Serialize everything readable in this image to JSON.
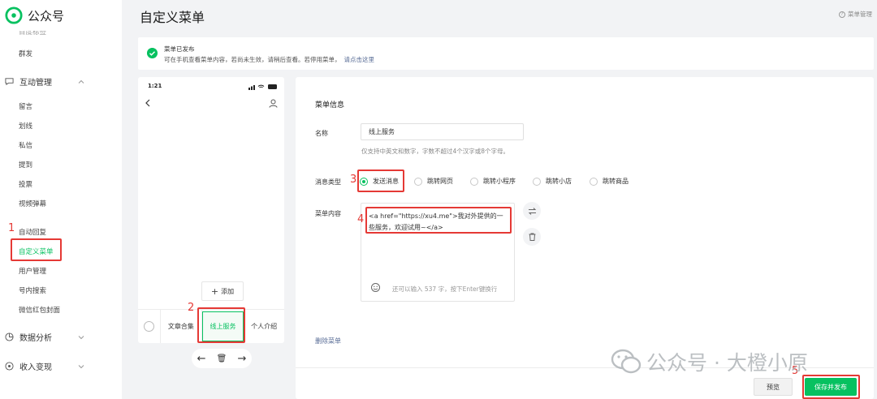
{
  "brand": {
    "name": "公众号"
  },
  "sidebar": {
    "cut_item": "百度标签",
    "items": [
      {
        "label": "群发"
      }
    ],
    "groups": {
      "interact": {
        "label": "互动管理",
        "items": [
          "留言",
          "划线",
          "私信",
          "提到",
          "投票",
          "视频弹幕"
        ]
      },
      "more_items": [
        "自动回复",
        "自定义菜单",
        "用户管理",
        "号内搜索",
        "微信红包封面"
      ],
      "analytics": {
        "label": "数据分析"
      },
      "revenue": {
        "label": "收入变现"
      }
    }
  },
  "header": {
    "title": "自定义菜单",
    "help": "菜单管理"
  },
  "notice": {
    "title": "菜单已发布",
    "text": "可在手机查看菜单内容，若尚未生效，请稍后查看。若停用菜单，",
    "link": "请点击这里"
  },
  "phone": {
    "time": "1:21",
    "add_label": "添加",
    "menus": [
      "文章合集",
      "线上服务",
      "个人介绍"
    ],
    "nav": {
      "prev": "←",
      "del": "🗑",
      "next": "→"
    }
  },
  "editor": {
    "section_title": "菜单信息",
    "name_label": "名称",
    "name_value": "线上服务",
    "name_hint": "仅支持中英文和数字，字数不超过4个汉字或8个字母。",
    "type_label": "消息类型",
    "types": [
      "发送消息",
      "跳转网页",
      "跳转小程序",
      "跳转小店",
      "跳转商品"
    ],
    "selected_type": "发送消息",
    "content_label": "菜单内容",
    "content_value": "<a href=\"https://xu4.me\">我对外提供的一些服务，欢迎试用~</a>",
    "char_hint": "还可以输入 537 字，按下Enter键换行",
    "delete_label": "删除菜单"
  },
  "footer": {
    "preview": "预览",
    "save": "保存并发布"
  },
  "annotations": [
    "1",
    "2",
    "3",
    "4",
    "5"
  ],
  "watermark": "公众号 · 大橙小原",
  "colors": {
    "accent": "#07c160",
    "link": "#576b95",
    "annotation": "#e53935"
  }
}
